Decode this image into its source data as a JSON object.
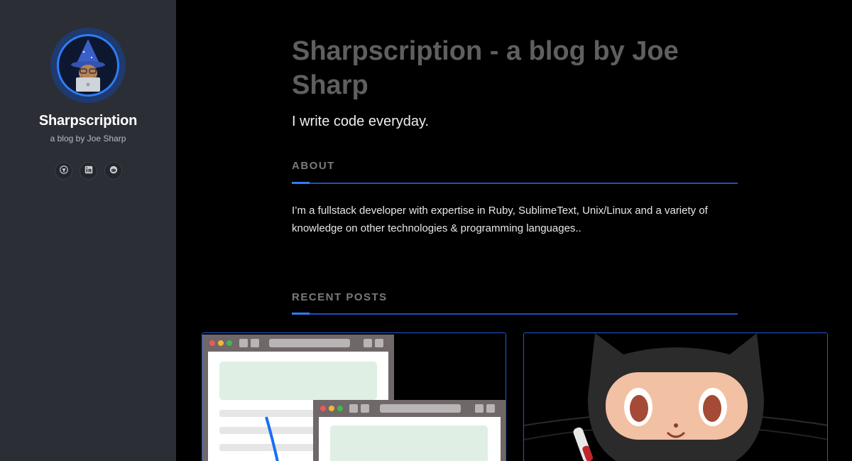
{
  "sidebar": {
    "title": "Sharpscription",
    "tagline": "a blog by Joe Sharp",
    "social": [
      {
        "icon": "github-icon"
      },
      {
        "icon": "linkedin-icon"
      },
      {
        "icon": "reddit-icon"
      }
    ]
  },
  "main": {
    "title": "Sharpscription - a blog by Joe Sharp",
    "lead": "I write code everyday.",
    "about": {
      "heading": "ABOUT",
      "text": "I’m a fullstack developer with expertise in Ruby, SublimeText, Unix/Linux and a variety of knowledge on other technologies & programming languages.."
    },
    "recent_posts": {
      "heading": "RECENT POSTS"
    }
  },
  "colors": {
    "sidebar_bg": "#2b2e35",
    "accent": "#2f7cf6",
    "title_gray": "#5f5f5f",
    "background": "#000000"
  }
}
